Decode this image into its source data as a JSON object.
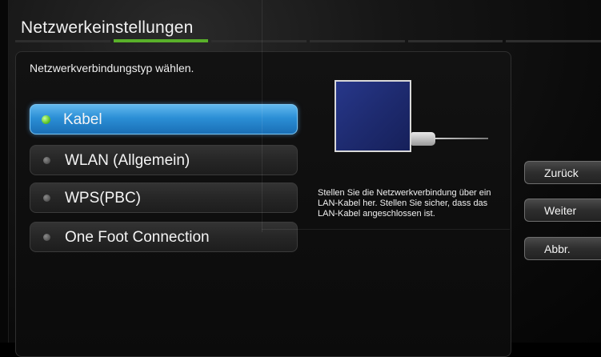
{
  "header": {
    "title": "Netzwerkeinstellungen",
    "steps_total": 6,
    "step_active": 2
  },
  "main": {
    "prompt": "Netzwerkverbindungstyp wählen.",
    "options": [
      {
        "label": "Kabel",
        "selected": true
      },
      {
        "label": "WLAN (Allgemein)",
        "selected": false
      },
      {
        "label": "WPS(PBC)",
        "selected": false
      },
      {
        "label": "One Foot Connection",
        "selected": false
      }
    ],
    "description": "Stellen Sie die Netzwerkverbindung über ein LAN-Kabel her. Stellen Sie sicher, dass das LAN-Kabel angeschlossen ist."
  },
  "nav": {
    "back_label": "Zurück",
    "next_label": "Weiter",
    "cancel_label": "Abbr."
  },
  "colors": {
    "accent_green": "#59b02a",
    "selected_blue": "#2b8fd6"
  }
}
